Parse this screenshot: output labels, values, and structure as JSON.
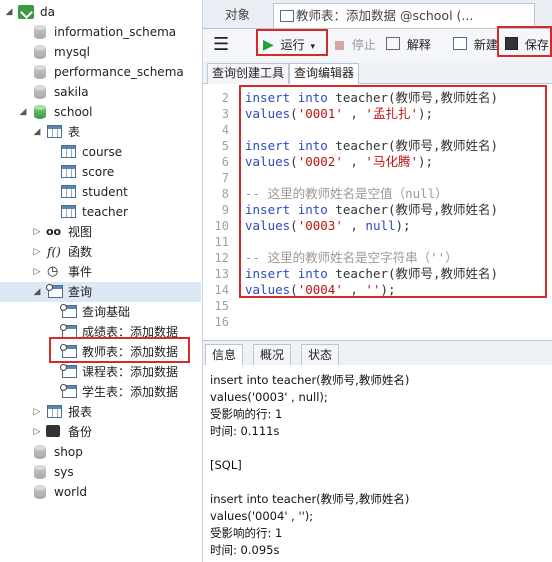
{
  "tree": {
    "connection": "da",
    "databases_top": [
      "information_schema",
      "mysql",
      "performance_schema",
      "sakila"
    ],
    "school": {
      "name": "school",
      "tables_label": "表",
      "tables": [
        "course",
        "score",
        "student",
        "teacher"
      ],
      "views_label": "视图",
      "functions_label": "函数",
      "events_label": "事件",
      "queries_label": "查询",
      "queries": [
        "查询基础",
        "成绩表：添加数据",
        "教师表：添加数据",
        "课程表：添加数据",
        "学生表：添加数据"
      ],
      "reports_label": "报表",
      "backup_label": "备份"
    },
    "databases_bottom": [
      "shop",
      "sys",
      "world"
    ]
  },
  "tabs": {
    "objects": "对象",
    "active": "教师表：添加数据 @school (..."
  },
  "toolbar": {
    "run": "运行",
    "stop": "停止",
    "explain": "解释",
    "new": "新建",
    "save": "保存"
  },
  "subtabs": [
    "查询创建工具",
    "查询编辑器"
  ],
  "editor": {
    "line_numbers": [
      "2",
      "3",
      "4",
      "5",
      "6",
      "7",
      "8",
      "9",
      "10",
      "11",
      "12",
      "13",
      "14",
      "15",
      "16"
    ],
    "lines": [
      "insert into teacher(教师号,教师姓名)",
      "values('0001' , '孟扎扎');",
      "",
      "insert into teacher(教师号,教师姓名)",
      "values('0002' , '马化腾');",
      "",
      "-- 这里的教师姓名是空值（null）",
      "insert into teacher(教师号,教师姓名)",
      "values('0003' , null);",
      "",
      "-- 这里的教师姓名是空字符串（''）",
      "insert into teacher(教师号,教师姓名)",
      "values('0004' , '');",
      "",
      ""
    ]
  },
  "bottom_tabs": [
    "信息",
    "概况",
    "状态"
  ],
  "messages": [
    "insert into teacher(教师号,教师姓名)",
    "values('0003' , null);",
    "受影响的行: 1",
    "时间: 0.111s",
    "",
    "[SQL]",
    "",
    "insert into teacher(教师号,教师姓名)",
    "values('0004' , '');",
    "受影响的行: 1",
    "时间: 0.095s"
  ],
  "colors": {
    "highlight": "#d42a2a",
    "keyword": "#2b48c8",
    "string": "#c01010",
    "comment": "#9a9a9a"
  }
}
